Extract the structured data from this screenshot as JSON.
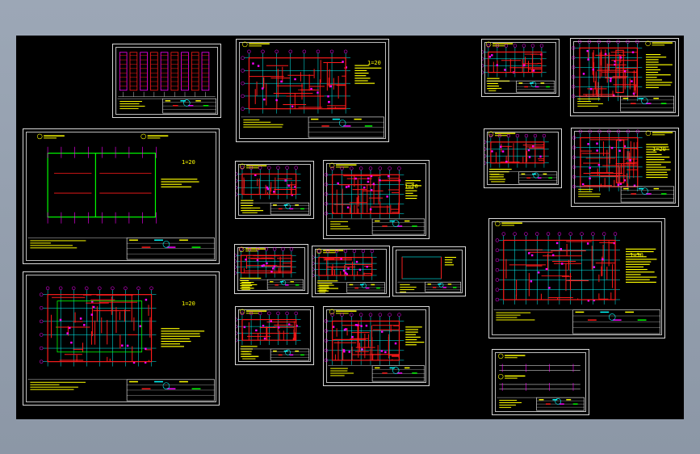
{
  "app": {
    "viewport_background": "#000000",
    "frame_background": "#97a2b1"
  },
  "colors": {
    "wall": "#ff1a1a",
    "dim": "#ff00ff",
    "grid": "#00ffff",
    "beam": "#00ff00",
    "note": "#ffff00",
    "line": "#ffffff",
    "blue": "#3b4bff"
  },
  "sheets": [
    {
      "id": "s1",
      "type": "rack",
      "scale": ""
    },
    {
      "id": "s2",
      "type": "big",
      "scale": "1=20"
    },
    {
      "id": "s3",
      "type": "bigplan",
      "scale": "1=20"
    },
    {
      "id": "s4",
      "type": "plan",
      "scale": "1=20"
    },
    {
      "id": "s5",
      "type": "small",
      "scale": ""
    },
    {
      "id": "s6",
      "type": "plan",
      "scale": "1=20"
    },
    {
      "id": "s7",
      "type": "small",
      "scale": ""
    },
    {
      "id": "s8",
      "type": "small",
      "scale": ""
    },
    {
      "id": "s9",
      "type": "simple",
      "scale": ""
    },
    {
      "id": "s10",
      "type": "small",
      "scale": ""
    },
    {
      "id": "s11",
      "type": "plan",
      "scale": ""
    },
    {
      "id": "s12",
      "type": "small",
      "scale": ""
    },
    {
      "id": "s13",
      "type": "side",
      "scale": ""
    },
    {
      "id": "s14",
      "type": "small",
      "scale": ""
    },
    {
      "id": "s15",
      "type": "side",
      "scale": "1=20"
    },
    {
      "id": "s16",
      "type": "grid",
      "scale": "1=30"
    },
    {
      "id": "s17",
      "type": "detail",
      "scale": ""
    }
  ]
}
